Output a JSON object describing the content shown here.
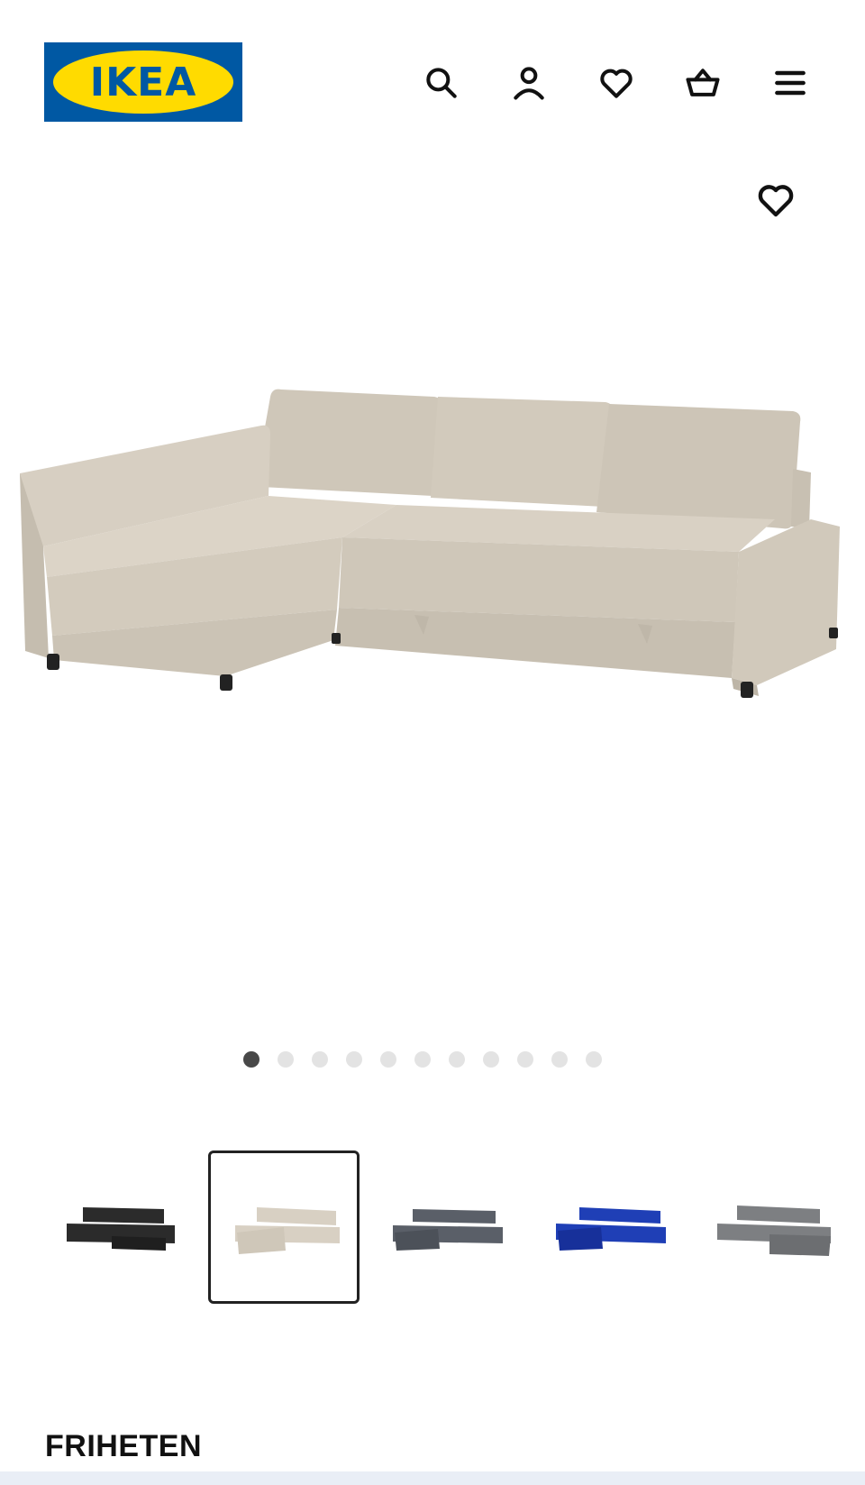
{
  "header": {
    "logo_text": "IKEA",
    "icons": [
      "search-icon",
      "profile-icon",
      "heart-icon",
      "basket-icon",
      "menu-icon"
    ]
  },
  "brand_colors": {
    "blue": "#0058a3",
    "yellow": "#ffdb00"
  },
  "gallery": {
    "favourite_icon": "heart-icon",
    "image_count": 11,
    "active_index": 0
  },
  "color_options": [
    {
      "name": "black",
      "color": "#2b2b2b",
      "selected": false
    },
    {
      "name": "beige",
      "color": "#d8d0c3",
      "selected": true
    },
    {
      "name": "dark-grey",
      "color": "#5a5f68",
      "selected": false
    },
    {
      "name": "blue",
      "color": "#1f3fb6",
      "selected": false
    },
    {
      "name": "grey",
      "color": "#7d7f82",
      "selected": false
    }
  ],
  "product": {
    "name": "FRIHETEN"
  }
}
